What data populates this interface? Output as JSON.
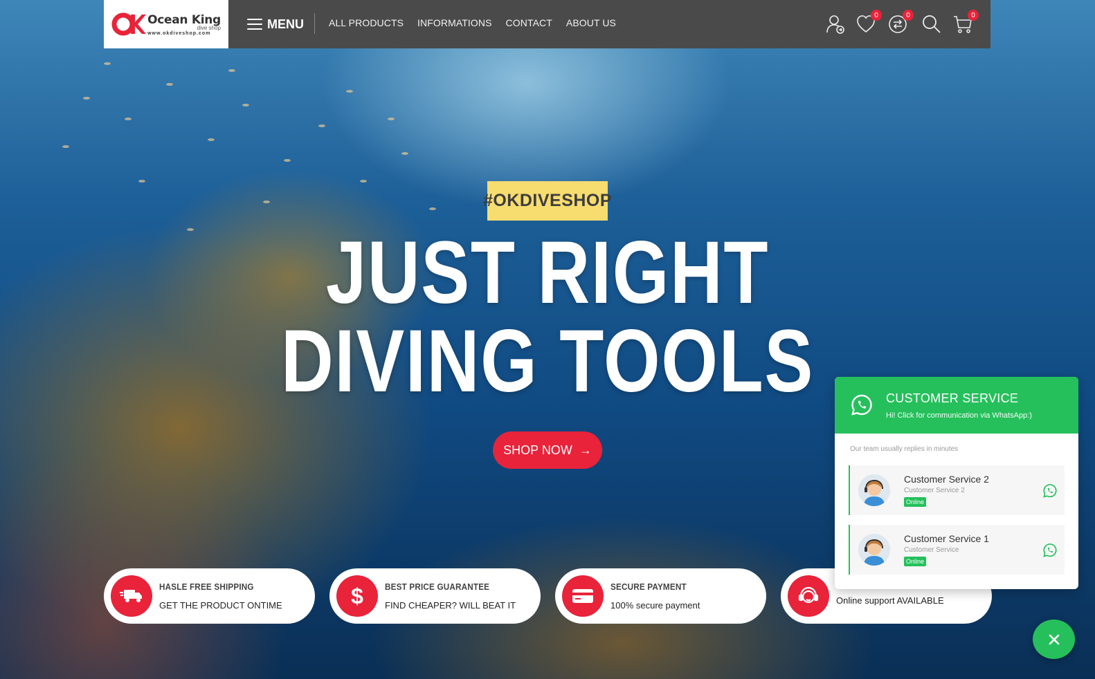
{
  "header": {
    "logo": {
      "title": "Ocean King",
      "subtitle": "dive shop",
      "url": "www.okdiveshop.com"
    },
    "menu_label": "MENU",
    "nav": [
      "ALL PRODUCTS",
      "INFORMATIONS",
      "CONTACT",
      "ABOUT US"
    ],
    "icons": {
      "account": "user-icon",
      "wishlist": "heart-icon",
      "compare": "compare-icon",
      "search": "search-icon",
      "cart": "cart-icon"
    },
    "wishlist_count": "0",
    "compare_count": "0",
    "cart_count": "0"
  },
  "hero": {
    "tag": "#OKDIVESHOP",
    "line1": "JUST RIGHT",
    "line2": "DIVING TOOLS",
    "button_label": "SHOP NOW",
    "button_arrow": "→"
  },
  "features": [
    {
      "icon": "truck-icon",
      "title": "HASLE FREE SHIPPING",
      "desc": "GET THE PRODUCT ONTIME"
    },
    {
      "icon": "dollar-icon",
      "title": "BEST PRICE GUARANTEE",
      "desc": "FIND CHEAPER? WILL BEAT IT"
    },
    {
      "icon": "credit-card-icon",
      "title": "SECURE PAYMENT",
      "desc": "100% secure payment"
    },
    {
      "icon": "support-agent-icon",
      "title": "",
      "desc": "Online support AVAILABLE"
    }
  ],
  "whatsapp": {
    "title": "CUSTOMER SERVICE",
    "subtitle": "Hi! Click for communication via WhatsApp:)",
    "note": "Our team usually replies in minutes",
    "agents": [
      {
        "name": "Customer Service 2",
        "role": "Customer Service 2",
        "status": "Online"
      },
      {
        "name": "Customer Service 1",
        "role": "Customer Service",
        "status": "Online"
      }
    ],
    "close_icon": "close-icon"
  },
  "colors": {
    "accent_red": "#e8233a",
    "header_bg": "#4a4a4a",
    "tag_yellow": "#f7dc6f",
    "whatsapp_green": "#25c05b"
  }
}
